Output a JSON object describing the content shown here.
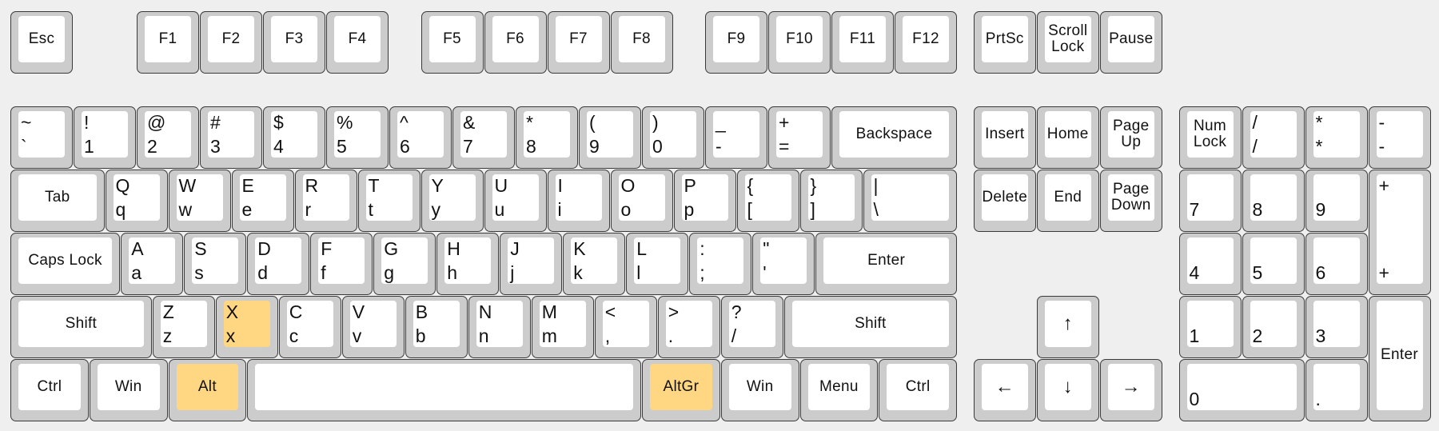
{
  "colors": {
    "background": "#efefef",
    "key_frame": "#cccccc",
    "key_cap": "#ffffff",
    "highlight": "#ffd782"
  },
  "keys": [
    {
      "name": "esc",
      "label": "Esc"
    },
    {
      "name": "f1",
      "label": "F1"
    },
    {
      "name": "f2",
      "label": "F2"
    },
    {
      "name": "f3",
      "label": "F3"
    },
    {
      "name": "f4",
      "label": "F4"
    },
    {
      "name": "f5",
      "label": "F5"
    },
    {
      "name": "f6",
      "label": "F6"
    },
    {
      "name": "f7",
      "label": "F7"
    },
    {
      "name": "f8",
      "label": "F8"
    },
    {
      "name": "f9",
      "label": "F9"
    },
    {
      "name": "f10",
      "label": "F10"
    },
    {
      "name": "f11",
      "label": "F11"
    },
    {
      "name": "f12",
      "label": "F12"
    },
    {
      "name": "prtsc",
      "label": "PrtSc"
    },
    {
      "name": "scroll-lock",
      "label": "Scroll\nLock"
    },
    {
      "name": "pause",
      "label": "Pause"
    },
    {
      "name": "backtick",
      "top": "~",
      "bottom": "`"
    },
    {
      "name": "1",
      "top": "!",
      "bottom": "1"
    },
    {
      "name": "2",
      "top": "@",
      "bottom": "2"
    },
    {
      "name": "3",
      "top": "#",
      "bottom": "3"
    },
    {
      "name": "4",
      "top": "$",
      "bottom": "4"
    },
    {
      "name": "5",
      "top": "%",
      "bottom": "5"
    },
    {
      "name": "6",
      "top": "^",
      "bottom": "6"
    },
    {
      "name": "7",
      "top": "&",
      "bottom": "7"
    },
    {
      "name": "8",
      "top": "*",
      "bottom": "8"
    },
    {
      "name": "9",
      "top": "(",
      "bottom": "9"
    },
    {
      "name": "0",
      "top": ")",
      "bottom": "0"
    },
    {
      "name": "minus",
      "top": "_",
      "bottom": "-"
    },
    {
      "name": "equals",
      "top": "+",
      "bottom": "="
    },
    {
      "name": "backspace",
      "label": "Backspace"
    },
    {
      "name": "insert",
      "label": "Insert"
    },
    {
      "name": "home",
      "label": "Home"
    },
    {
      "name": "page-up",
      "label": "Page\nUp"
    },
    {
      "name": "num-lock",
      "label": "Num\nLock"
    },
    {
      "name": "num-divide",
      "top": "/",
      "bottom": "/"
    },
    {
      "name": "num-multiply",
      "top": "*",
      "bottom": "*"
    },
    {
      "name": "num-minus",
      "top": "-",
      "bottom": "-"
    },
    {
      "name": "tab",
      "label": "Tab"
    },
    {
      "name": "q",
      "top": "Q",
      "bottom": "q"
    },
    {
      "name": "w",
      "top": "W",
      "bottom": "w"
    },
    {
      "name": "e",
      "top": "E",
      "bottom": "e"
    },
    {
      "name": "r",
      "top": "R",
      "bottom": "r"
    },
    {
      "name": "t",
      "top": "T",
      "bottom": "t"
    },
    {
      "name": "y",
      "top": "Y",
      "bottom": "y"
    },
    {
      "name": "u",
      "top": "U",
      "bottom": "u"
    },
    {
      "name": "i",
      "top": "I",
      "bottom": "i"
    },
    {
      "name": "o",
      "top": "O",
      "bottom": "o"
    },
    {
      "name": "p",
      "top": "P",
      "bottom": "p"
    },
    {
      "name": "left-bracket",
      "top": "{",
      "bottom": "["
    },
    {
      "name": "right-bracket",
      "top": "}",
      "bottom": "]"
    },
    {
      "name": "backslash",
      "top": "|",
      "bottom": "\\"
    },
    {
      "name": "delete",
      "label": "Delete"
    },
    {
      "name": "end",
      "label": "End"
    },
    {
      "name": "page-down",
      "label": "Page\nDown"
    },
    {
      "name": "num-7",
      "bottom": "7"
    },
    {
      "name": "num-8",
      "bottom": "8"
    },
    {
      "name": "num-9",
      "bottom": "9"
    },
    {
      "name": "num-plus",
      "top": "+",
      "bottom": "+"
    },
    {
      "name": "caps-lock",
      "label": "Caps Lock"
    },
    {
      "name": "a",
      "top": "A",
      "bottom": "a"
    },
    {
      "name": "s",
      "top": "S",
      "bottom": "s"
    },
    {
      "name": "d",
      "top": "D",
      "bottom": "d"
    },
    {
      "name": "f",
      "top": "F",
      "bottom": "f"
    },
    {
      "name": "g",
      "top": "G",
      "bottom": "g"
    },
    {
      "name": "h",
      "top": "H",
      "bottom": "h"
    },
    {
      "name": "j",
      "top": "J",
      "bottom": "j"
    },
    {
      "name": "k",
      "top": "K",
      "bottom": "k"
    },
    {
      "name": "l",
      "top": "L",
      "bottom": "l"
    },
    {
      "name": "semicolon",
      "top": ":",
      "bottom": ";"
    },
    {
      "name": "quote",
      "top": "\"",
      "bottom": "'"
    },
    {
      "name": "enter",
      "label": "Enter"
    },
    {
      "name": "num-4",
      "bottom": "4"
    },
    {
      "name": "num-5",
      "bottom": "5"
    },
    {
      "name": "num-6",
      "bottom": "6"
    },
    {
      "name": "left-shift",
      "label": "Shift"
    },
    {
      "name": "z",
      "top": "Z",
      "bottom": "z"
    },
    {
      "name": "x",
      "top": "X",
      "bottom": "x",
      "highlighted": true
    },
    {
      "name": "c",
      "top": "C",
      "bottom": "c"
    },
    {
      "name": "v",
      "top": "V",
      "bottom": "v"
    },
    {
      "name": "b",
      "top": "B",
      "bottom": "b"
    },
    {
      "name": "n",
      "top": "N",
      "bottom": "n"
    },
    {
      "name": "m",
      "top": "M",
      "bottom": "m"
    },
    {
      "name": "comma",
      "top": "<",
      "bottom": ","
    },
    {
      "name": "period",
      "top": ">",
      "bottom": "."
    },
    {
      "name": "slash",
      "top": "?",
      "bottom": "/"
    },
    {
      "name": "right-shift",
      "label": "Shift"
    },
    {
      "name": "arrow-up",
      "label": "↑",
      "icon": "arrow-up-icon"
    },
    {
      "name": "num-1",
      "bottom": "1"
    },
    {
      "name": "num-2",
      "bottom": "2"
    },
    {
      "name": "num-3",
      "bottom": "3"
    },
    {
      "name": "num-enter",
      "label": "Enter"
    },
    {
      "name": "left-ctrl",
      "label": "Ctrl"
    },
    {
      "name": "left-win",
      "label": "Win"
    },
    {
      "name": "left-alt",
      "label": "Alt",
      "highlighted": true
    },
    {
      "name": "space",
      "label": ""
    },
    {
      "name": "altgr",
      "label": "AltGr",
      "highlighted": true
    },
    {
      "name": "right-win",
      "label": "Win"
    },
    {
      "name": "menu",
      "label": "Menu"
    },
    {
      "name": "right-ctrl",
      "label": "Ctrl"
    },
    {
      "name": "arrow-left",
      "label": "←",
      "icon": "arrow-left-icon"
    },
    {
      "name": "arrow-down",
      "label": "↓",
      "icon": "arrow-down-icon"
    },
    {
      "name": "arrow-right",
      "label": "→",
      "icon": "arrow-right-icon"
    },
    {
      "name": "num-0",
      "bottom": "0"
    },
    {
      "name": "num-decimal",
      "bottom": "."
    }
  ]
}
